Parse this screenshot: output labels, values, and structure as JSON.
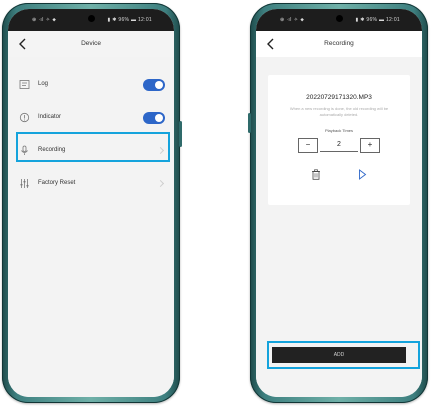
{
  "left_screen": {
    "status_bar": {
      "left": "⊕ ᐧıl ✧ ⬥",
      "right": "▮ ✱ 96% ▬ 12:01"
    },
    "header": {
      "title": "Device"
    },
    "items": [
      {
        "label": "Log",
        "icon": "log-icon",
        "control": "toggle",
        "state": "on"
      },
      {
        "label": "Indicator",
        "icon": "indicator-icon",
        "control": "toggle",
        "state": "on"
      },
      {
        "label": "Recording",
        "icon": "microphone-icon",
        "control": "chevron"
      },
      {
        "label": "Factory Reset",
        "icon": "reset-sliders-icon",
        "control": "chevron"
      }
    ]
  },
  "right_screen": {
    "status_bar": {
      "left": "⊕ ᐧıl ✧ ⬥",
      "right": "▮ ✱ 96% ▬ 12:01"
    },
    "header": {
      "title": "Recording"
    },
    "recording": {
      "file_name": "20220729171320.MP3",
      "note": "When a new recording is done, the old recording will be automatically deleted.",
      "playback_label": "Playback Times",
      "minus": "−",
      "value": "2",
      "plus": "+"
    },
    "add_label": "ADD"
  },
  "colors": {
    "accent": "#2d66c8",
    "highlight": "#14a3dc",
    "phone_body": "#3d7f7f",
    "button_dark": "#222222"
  }
}
